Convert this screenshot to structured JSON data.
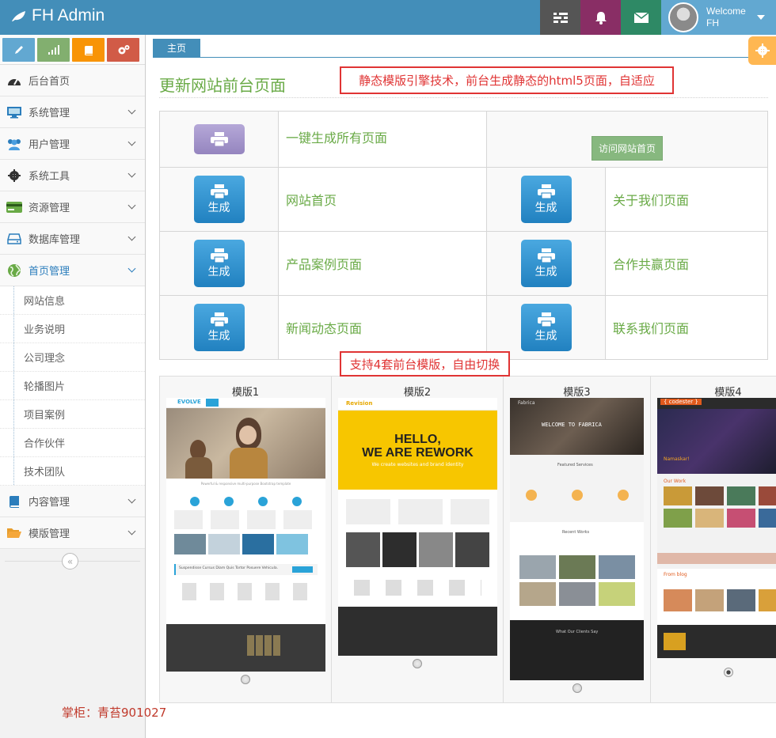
{
  "topbar": {
    "title": "FH Admin",
    "welcome": "Welcome",
    "username": "FH",
    "colors": {
      "bg": "#438eb9",
      "tasks": "#555555",
      "notifications": "#892e65",
      "messages": "#2e8965",
      "user": "#62a8d1"
    }
  },
  "shortcuts": [
    {
      "icon": "pencil-icon",
      "color": "#62a8d1"
    },
    {
      "icon": "signal-icon",
      "color": "#82af6f"
    },
    {
      "icon": "book-icon",
      "color": "#f89406"
    },
    {
      "icon": "cogs-icon",
      "color": "#d15b47"
    }
  ],
  "sidebar": {
    "items": [
      {
        "label": "后台首页",
        "icon": "dashboard-icon"
      },
      {
        "label": "系统管理",
        "icon": "desktop-icon"
      },
      {
        "label": "用户管理",
        "icon": "users-icon"
      },
      {
        "label": "系统工具",
        "icon": "cog-icon"
      },
      {
        "label": "资源管理",
        "icon": "credit-card-icon"
      },
      {
        "label": "数据库管理",
        "icon": "hdd-icon"
      },
      {
        "label": "首页管理",
        "icon": "globe-icon"
      }
    ],
    "subitems": [
      "网站信息",
      "业务说明",
      "公司理念",
      "轮播图片",
      "项目案例",
      "合作伙伴",
      "技术团队"
    ],
    "items2": [
      {
        "label": "内容管理",
        "icon": "book-icon"
      },
      {
        "label": "模版管理",
        "icon": "folder-open-icon"
      }
    ],
    "collapse": "«"
  },
  "tab": {
    "label": "主页"
  },
  "page": {
    "title": "更新网站前台页面",
    "note1": "静态模版引擎技术，前台生成静态的html5页面，自适应",
    "note2": "支持4套前台模版，自由切换",
    "generate_all": "一键生成所有页面",
    "visit": "访问网站首页",
    "gen_label": "生成",
    "pages": [
      "网站首页",
      "关于我们页面",
      "产品案例页面",
      "合作共赢页面",
      "新闻动态页面",
      "联系我们页面"
    ]
  },
  "templates": [
    {
      "name": "模版1",
      "logo": "EVOLVE",
      "tagline": "Powerful & responsive multi-purpose Bootstrap template",
      "banner": "Suspendisse Cursus Diam Quis Tortor Posuere Vehicula.",
      "selected": false
    },
    {
      "name": "模版2",
      "logo": "Revision",
      "headline1": "HELLO,",
      "headline2": "WE ARE REWORK",
      "sub": "We create websites and brand identity",
      "selected": false
    },
    {
      "name": "模版3",
      "logo": "Fabrica",
      "welcome": "WELCOME TO FABRICA",
      "sub": "Featured Services",
      "recent": "Recent Works",
      "clients": "What Our Clients Say",
      "selected": false
    },
    {
      "name": "模版4",
      "logo": "{ codester }",
      "hello": "Namaskar!",
      "work": "Our Work",
      "blog": "From blog",
      "selected": true
    }
  ],
  "footer": {
    "note": "掌柜：青苔901027"
  }
}
